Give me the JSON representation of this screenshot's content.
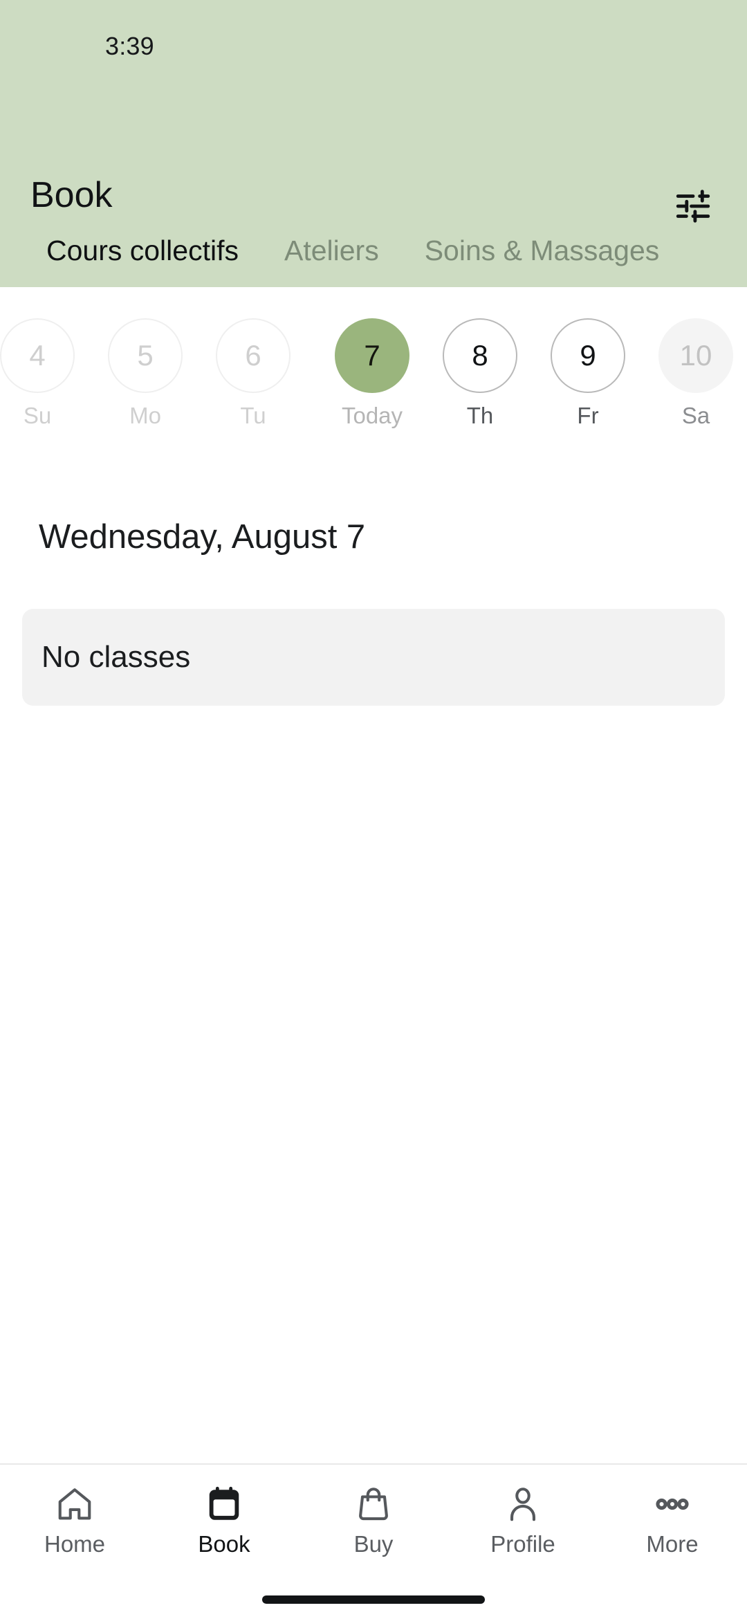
{
  "status_bar": {
    "time": "3:39"
  },
  "header": {
    "title": "Book",
    "filter_icon": "tune-filter-icon",
    "background_color": "#cddcc2"
  },
  "tabs": [
    {
      "label": "Cours collectifs",
      "active": true
    },
    {
      "label": "Ateliers",
      "active": false
    },
    {
      "label": "Soins & Massages",
      "active": false
    }
  ],
  "date_strip": {
    "days": [
      {
        "date": "4",
        "weekday": "Su",
        "state": "disabled"
      },
      {
        "date": "5",
        "weekday": "Mo",
        "state": "disabled"
      },
      {
        "date": "6",
        "weekday": "Tu",
        "state": "disabled"
      },
      {
        "date": "7",
        "weekday": "Today",
        "state": "selected"
      },
      {
        "date": "8",
        "weekday": "Th",
        "state": "normal"
      },
      {
        "date": "9",
        "weekday": "Fr",
        "state": "normal"
      },
      {
        "date": "10",
        "weekday": "Sa",
        "state": "faded"
      }
    ],
    "selected_color": "#9ab57d"
  },
  "schedule": {
    "day_heading": "Wednesday, August 7",
    "empty_message": "No classes"
  },
  "bottom_nav": {
    "items": [
      {
        "label": "Home",
        "icon": "home-icon",
        "active": false
      },
      {
        "label": "Book",
        "icon": "calendar-icon",
        "active": true
      },
      {
        "label": "Buy",
        "icon": "bag-icon",
        "active": false
      },
      {
        "label": "Profile",
        "icon": "person-icon",
        "active": false
      },
      {
        "label": "More",
        "icon": "ellipsis-icon",
        "active": false
      }
    ]
  }
}
